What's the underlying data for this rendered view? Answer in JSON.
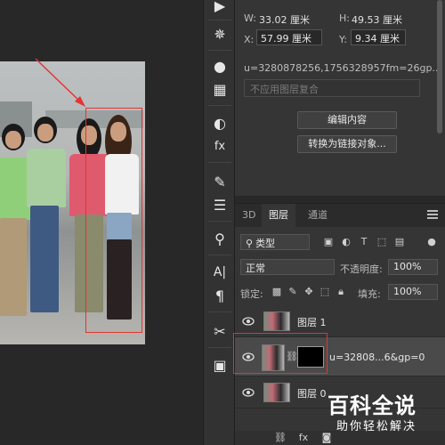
{
  "properties": {
    "w_label": "W:",
    "w_value": "33.02 厘米",
    "h_label": "H:",
    "h_value": "49.53 厘米",
    "x_label": "X:",
    "x_value": "57.99 厘米",
    "y_label": "Y:",
    "y_value": "9.34 厘米",
    "source_name": "u=3280878256,1756328957fm=26gp...",
    "comp_select": "不应用图层复合",
    "edit_contents_button": "编辑内容",
    "convert_link_button": "转换为链接对象..."
  },
  "layers_panel": {
    "tabs": [
      {
        "label": "3D"
      },
      {
        "label": "图层"
      },
      {
        "label": "通道"
      }
    ],
    "filter_kind": "类型",
    "blend_mode": "正常",
    "opacity_label": "不透明度:",
    "opacity_value": "100%",
    "lock_label": "锁定:",
    "fill_label": "填充:",
    "fill_value": "100%",
    "layers": [
      {
        "name": "图层 1"
      },
      {
        "name": "u=32808...6&gp=0"
      },
      {
        "name": "图层 0"
      }
    ]
  },
  "watermark": {
    "title": "百科全说",
    "subtitle": "助你轻松解决"
  },
  "colors": {
    "highlight": "#e23434",
    "panel_bg": "#353535",
    "canvas_bg": "#282828"
  }
}
